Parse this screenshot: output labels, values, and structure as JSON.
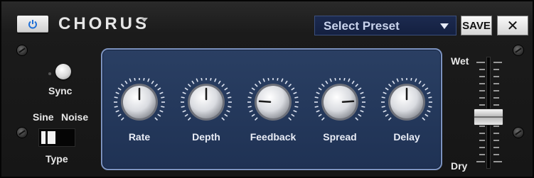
{
  "header": {
    "title": "CHORUS",
    "preset": {
      "label": "Select Preset"
    },
    "save_label": "SAVE",
    "close_label": "✕"
  },
  "controls": {
    "sync_label": "Sync",
    "type": {
      "option_left": "Sine",
      "option_right": "Noise",
      "label": "Type",
      "selected": "Sine"
    }
  },
  "knobs": [
    {
      "label": "Rate",
      "value": 0.5
    },
    {
      "label": "Depth",
      "value": 0.5
    },
    {
      "label": "Feedback",
      "value": 0.18
    },
    {
      "label": "Spread",
      "value": 0.82
    },
    {
      "label": "Delay",
      "value": 0.5
    }
  ],
  "mix": {
    "top_label": "Wet",
    "bottom_label": "Dry",
    "value": 0.5
  },
  "colors": {
    "panel_blue": "#243a5e",
    "preset_blue": "#1b2a4e",
    "power_icon": "#1e6fd6"
  }
}
